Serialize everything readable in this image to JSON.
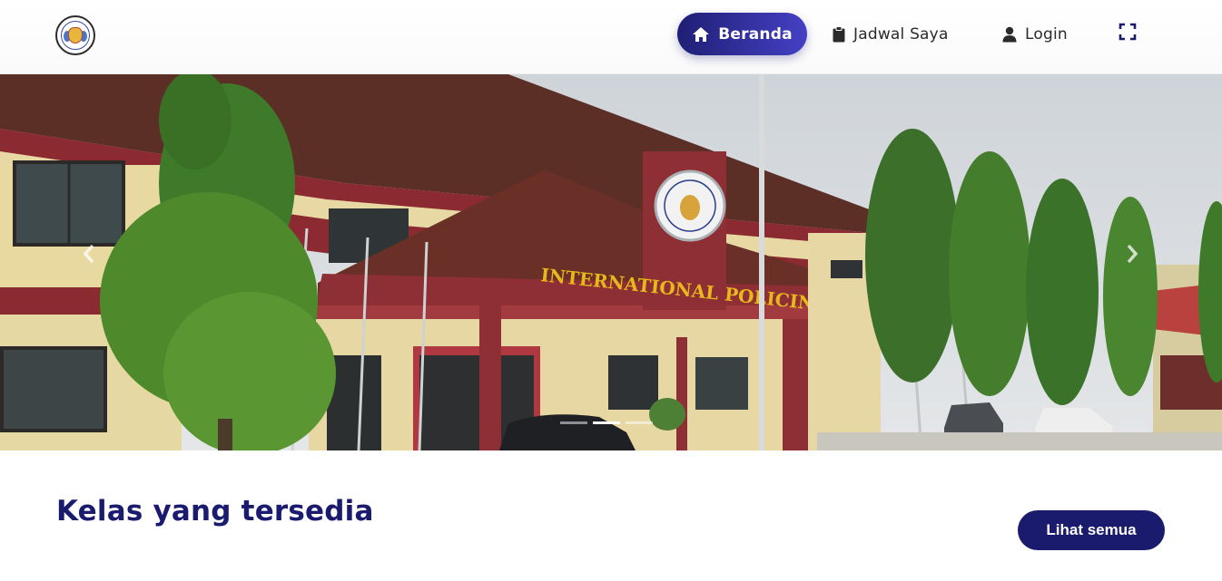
{
  "navbar": {
    "logo_icon": "school-emblem-logo",
    "items": [
      {
        "label": "Beranda",
        "icon": "home-icon",
        "active": true
      },
      {
        "label": "Jadwal Saya",
        "icon": "clipboard-icon",
        "active": false
      },
      {
        "label": "Login",
        "icon": "user-icon",
        "active": false
      }
    ],
    "fullscreen_icon": "fullscreen-icon"
  },
  "hero": {
    "building_sign": "INTERNATIONAL POLICING SCHOOL",
    "indicators": 3,
    "active_indicator": 2,
    "prev_icon": "chevron-left-icon",
    "next_icon": "chevron-right-icon"
  },
  "classes": {
    "title": "Kelas yang tersedia",
    "see_all_label": "Lihat semua"
  },
  "colors": {
    "primary": "#1b1b6e",
    "accent_gradient_end": "#4540c4",
    "title": "#1a1a6e"
  }
}
